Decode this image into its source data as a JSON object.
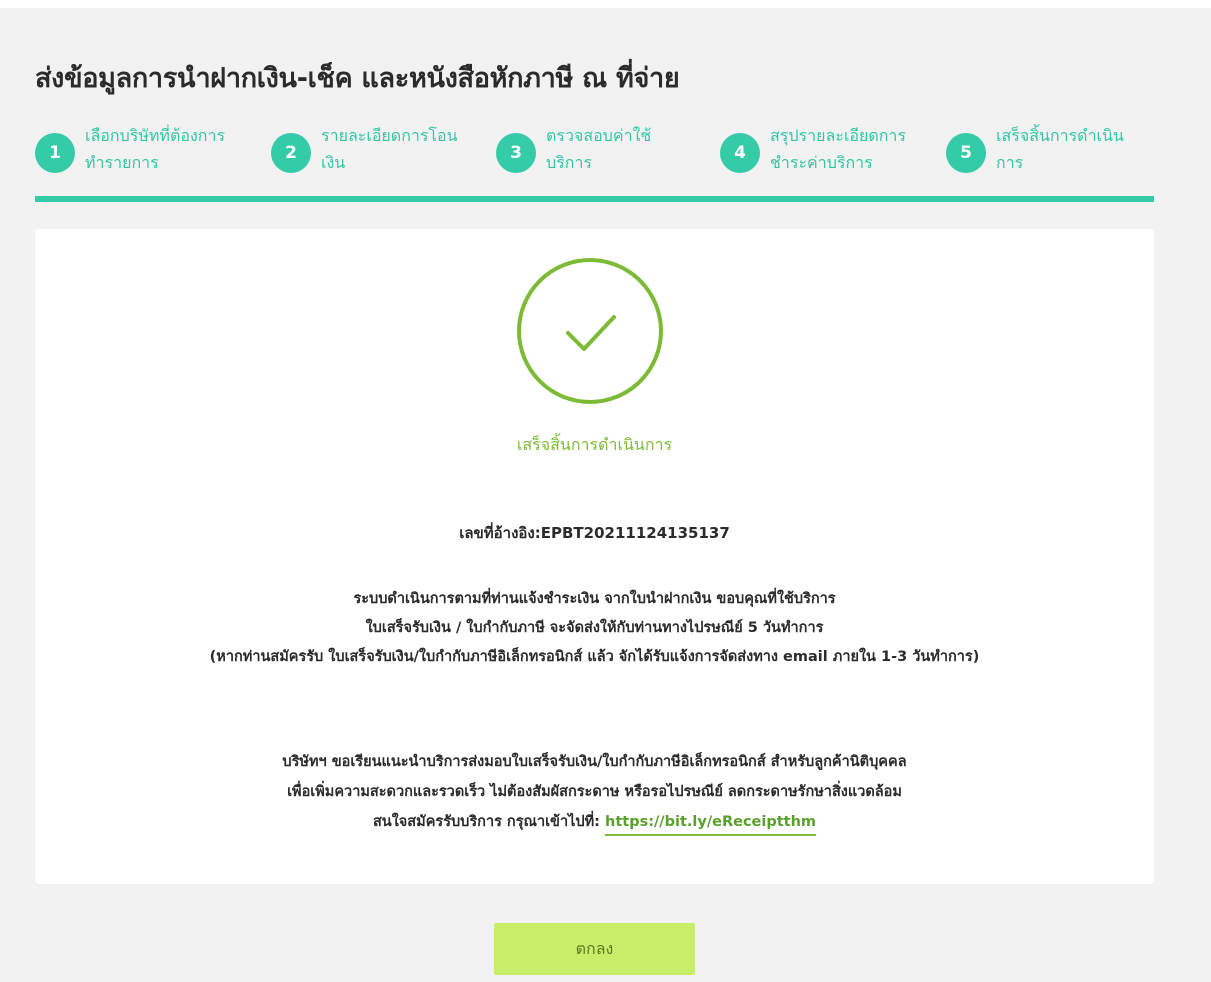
{
  "page": {
    "title": "ส่งข้อมูลการนำฝากเงิน-เช็ค และหนังสือหักภาษี ณ ที่จ่าย"
  },
  "steps": [
    {
      "number": "1",
      "line1": "เลือกบริษัทที่ต้องการ",
      "line2": "ทำรายการ"
    },
    {
      "number": "2",
      "line1": "รายละเอียดการโอน",
      "line2": "เงิน"
    },
    {
      "number": "3",
      "line1": "ตรวจสอบค่าใช้",
      "line2": "บริการ"
    },
    {
      "number": "4",
      "line1": "สรุปรายละเอียดการ",
      "line2": "ชำระค่าบริการ"
    },
    {
      "number": "5",
      "line1": "เสร็จสิ้นการดำเนิน",
      "line2": "การ"
    }
  ],
  "result": {
    "status_text": "เสร็จสิ้นการดำเนินการ",
    "reference_line": "เลขที่อ้างอิง:EPBT20211124135137",
    "info_lines": [
      "ระบบดำเนินการตามที่ท่านแจ้งชำระเงิน จากใบนำฝากเงิน ขอบคุณที่ใช้บริการ",
      "ใบเสร็จรับเงิน / ใบกำกับภาษี จะจัดส่งให้กับท่านทางไปรษณีย์ 5 วันทำการ",
      "(หากท่านสมัครรับ ใบเสร็จรับเงิน/ใบกำกับภาษีอิเล็กทรอนิกส์ แล้ว จักได้รับแจ้งการจัดส่งทาง email ภายใน 1-3 วันทำการ)"
    ],
    "promo_lines": [
      "บริษัทฯ ขอเรียนแนะนำบริการส่งมอบใบเสร็จรับเงิน/ใบกำกับภาษีอิเล็กทรอนิกส์ สำหรับลูกค้านิติบุคคล",
      "เพื่อเพิ่มความสะดวกและรวดเร็ว ไม่ต้องสัมผัสกระดาษ หรือรอไปรษณีย์ ลดกระดาษรักษาสิ่งแวดล้อม"
    ],
    "promo_prefix": "สนใจสมัครรับบริการ กรุณาเข้าไปที่: ",
    "promo_link": "https://bit.ly/eReceiptthm"
  },
  "actions": {
    "ok_label": "ตกลง"
  },
  "colors": {
    "accent_teal": "#33cca6",
    "success_green": "#7dbb36",
    "button_lime": "#c8ee6a"
  },
  "icons": {
    "success": "check-circle-icon"
  }
}
